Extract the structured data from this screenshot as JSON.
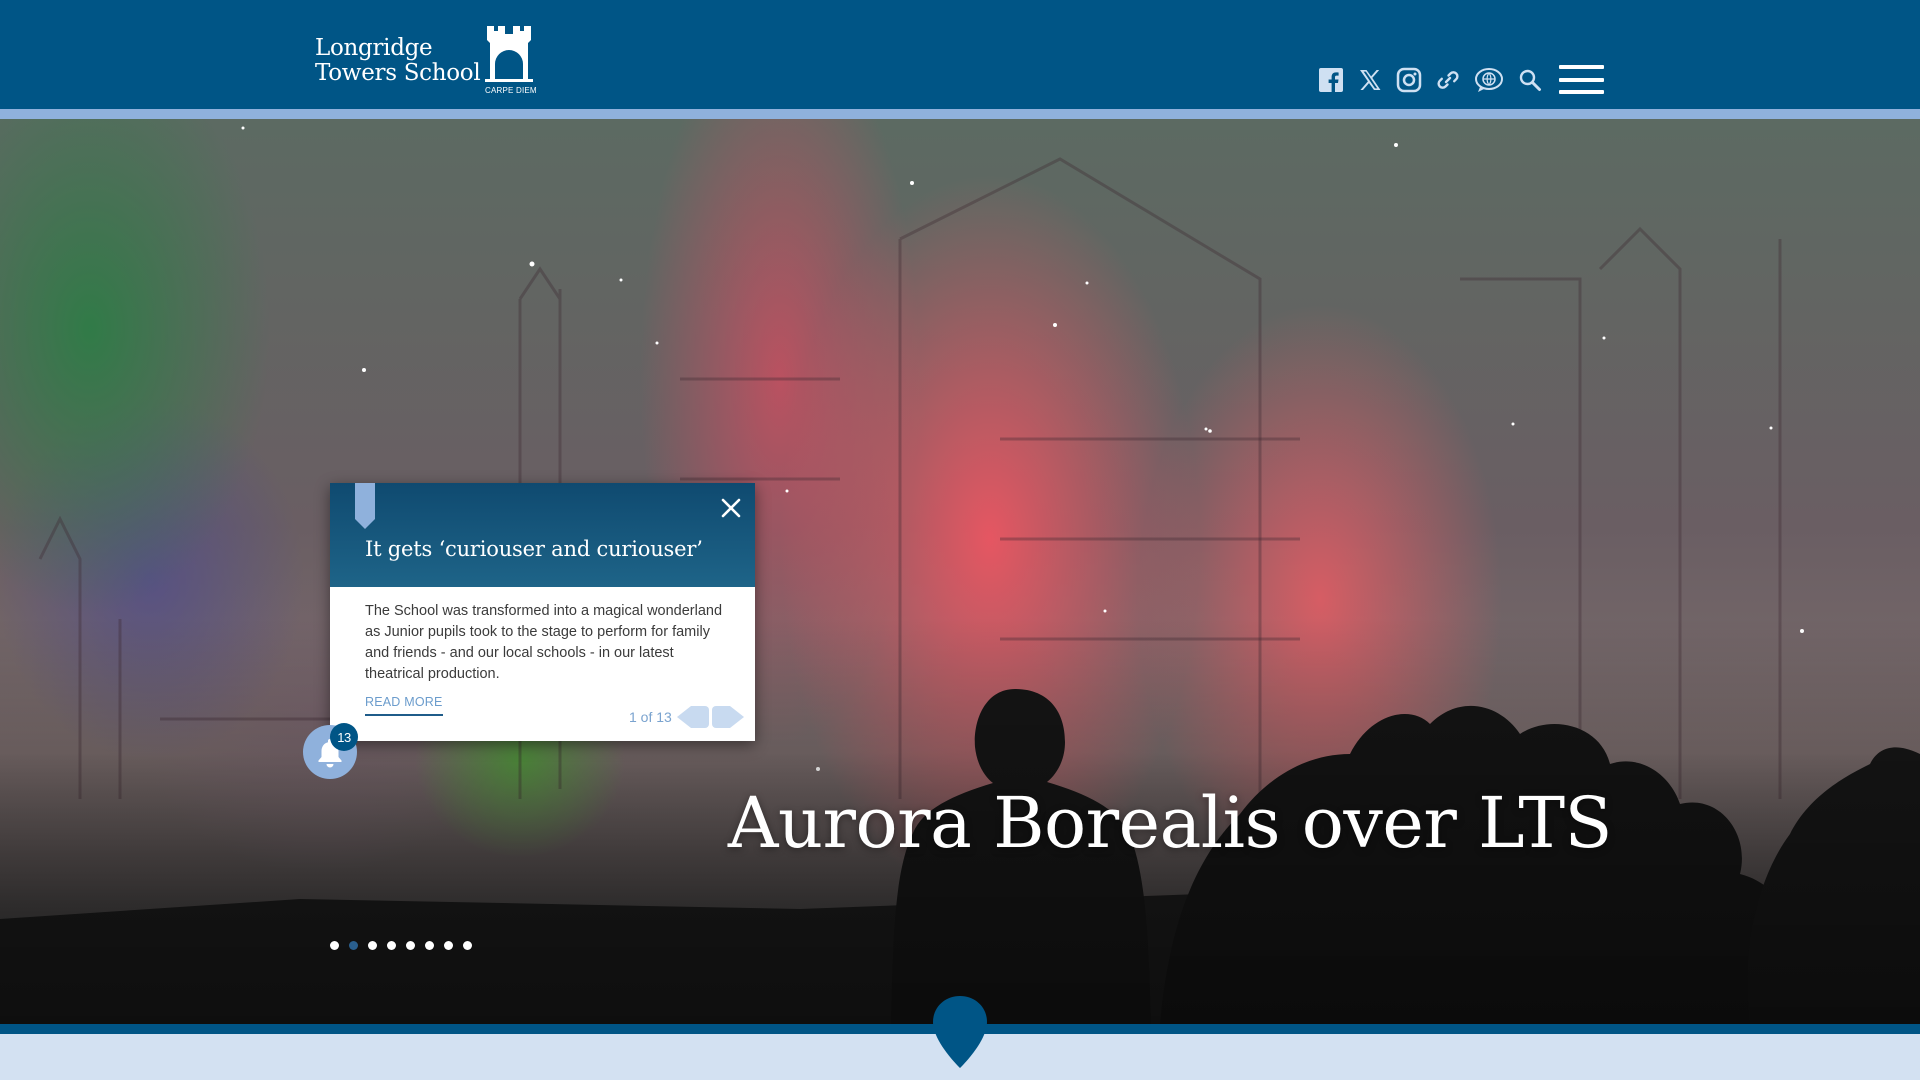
{
  "header": {
    "logo_line1": "Longridge",
    "logo_line2": "Towers School",
    "logo_motto": "CARPE DIEM",
    "social_icons": [
      "facebook-icon",
      "x-icon",
      "instagram-icon",
      "link-icon",
      "globe-chat-icon",
      "search-icon"
    ],
    "menu_icon": "hamburger-menu-icon"
  },
  "colors": {
    "header_bg": "#005586",
    "accent_light": "#8fb1dc",
    "bottom_band": "#d3e1f2",
    "active_dot": "#2a5f8e",
    "link": "#6b9ccc"
  },
  "hero": {
    "title": "Aurora Borealis over LTS",
    "slide_count": 8,
    "active_slide": 2
  },
  "notification": {
    "title": "It gets ‘curiouser and curiouser’",
    "body": "The School was transformed into a magical wonderland as Junior pupils took to the stage to perform for family and friends - and our local schools - in our latest theatrical production.",
    "read_more": "READ MORE",
    "counter": "1 of 13",
    "badge_count": "13"
  }
}
